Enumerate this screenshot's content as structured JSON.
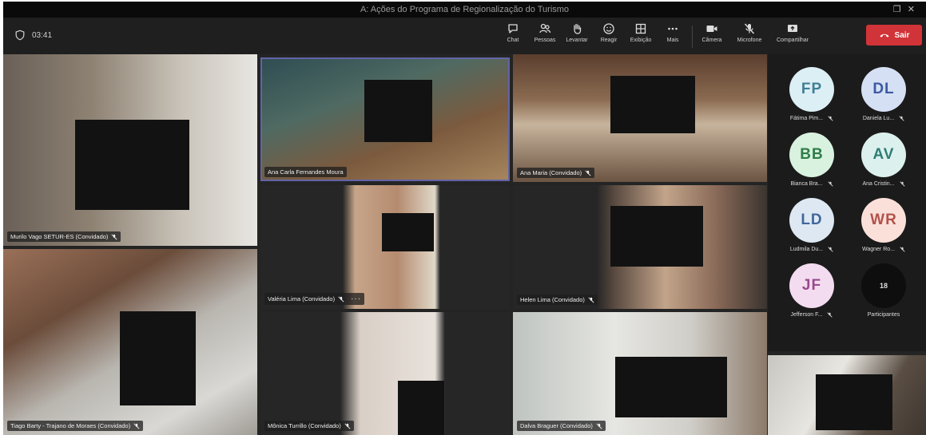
{
  "window": {
    "title": "A: Ações do Programa de Regionalização do Turismo"
  },
  "toolbar": {
    "timer": "03:41",
    "tools": {
      "chat": "Chat",
      "people": "Pessoas",
      "raise": "Levantar",
      "react": "Reagir",
      "view": "Exibição",
      "more": "Mais",
      "camera": "Câmera",
      "mic": "Microfone",
      "share": "Compartilhar"
    },
    "leave": "Sair"
  },
  "tiles": {
    "murilo": "Murilo Vago SETUR-ES (Convidado)",
    "ana_carla": "Ana Carla Fernandes Moura",
    "ana_maria": "Ana Maria (Convidado)",
    "tiago": "Tiago Barty - Trajano de Moraes (Convidado)",
    "valeria": "Valéria Lima (Convidado)",
    "helen": "Helen Lima (Convidado)",
    "monica": "Mônica Turrillo (Convidado)",
    "dalva": "Dalva Braguer (Convidado)"
  },
  "roster": {
    "participants": [
      {
        "initials": "FP",
        "name": "Fátima Pim...",
        "bg": "#dceff4",
        "fg": "#3e7f96"
      },
      {
        "initials": "DL",
        "name": "Daniela Lu...",
        "bg": "#d6e0f5",
        "fg": "#3b5aa0"
      },
      {
        "initials": "BB",
        "name": "Bianca Bra...",
        "bg": "#d8f2df",
        "fg": "#2f7d47"
      },
      {
        "initials": "AV",
        "name": "Ana Cristin...",
        "bg": "#dcf1ee",
        "fg": "#2e7d72"
      },
      {
        "initials": "LD",
        "name": "Ludmila Du...",
        "bg": "#dde8f3",
        "fg": "#41679a"
      },
      {
        "initials": "WR",
        "name": "Wagner Ro...",
        "bg": "#fbe0da",
        "fg": "#b2524a"
      },
      {
        "initials": "JF",
        "name": "Jefferson F...",
        "bg": "#f4dcf0",
        "fg": "#9a4a8e"
      }
    ],
    "more": {
      "count": "18",
      "label": "Participantes"
    }
  }
}
